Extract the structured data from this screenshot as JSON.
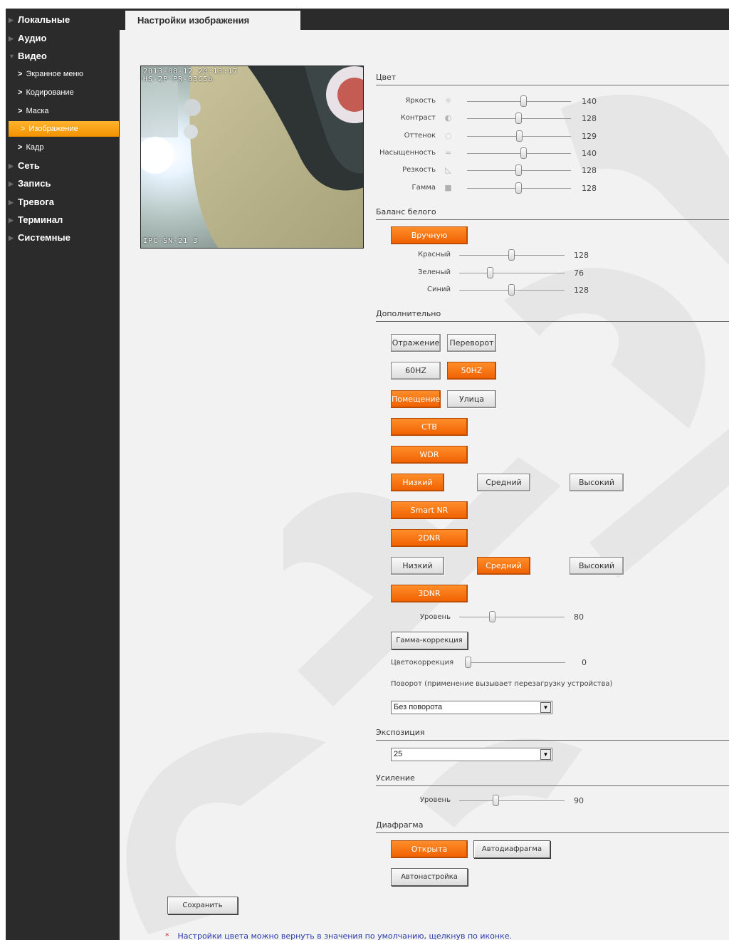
{
  "sidebar": {
    "items": [
      {
        "label": "Локальные"
      },
      {
        "label": "Аудио"
      },
      {
        "label": "Видео"
      },
      {
        "label": "Экранное меню"
      },
      {
        "label": "Кодирование"
      },
      {
        "label": "Маска"
      },
      {
        "label": "Изображение"
      },
      {
        "label": "Кадр"
      },
      {
        "label": "Сеть"
      },
      {
        "label": "Запись"
      },
      {
        "label": "Тревога"
      },
      {
        "label": "Терминал"
      },
      {
        "label": "Системные"
      }
    ],
    "active": "Изображение"
  },
  "tab": {
    "title": "Настройки изображения"
  },
  "preview": {
    "timestamp": "2013-08-12 20:13:17",
    "camera": "HS-2P PR-03C5b",
    "caption": "IPC-SN-21 3"
  },
  "color": {
    "title": "Цвет",
    "sliders": [
      {
        "label": "Яркость",
        "icon": "sun-icon",
        "value": "140",
        "fraction": 0.55
      },
      {
        "label": "Контраст",
        "icon": "contrast-icon",
        "value": "128",
        "fraction": 0.5
      },
      {
        "label": "Оттенок",
        "icon": "hue-icon",
        "value": "129",
        "fraction": 0.505
      },
      {
        "label": "Насыщенность",
        "icon": "saturation-icon",
        "value": "140",
        "fraction": 0.55
      },
      {
        "label": "Резкость",
        "icon": "sharpness-icon",
        "value": "128",
        "fraction": 0.5
      },
      {
        "label": "Гамма",
        "icon": "gamma-icon",
        "value": "128",
        "fraction": 0.5
      }
    ]
  },
  "white_balance": {
    "title": "Баланс белого",
    "mode_label": "Вручную",
    "sliders": [
      {
        "label": "Красный",
        "value": "128",
        "fraction": 0.5
      },
      {
        "label": "Зеленый",
        "value": "76",
        "fraction": 0.3
      },
      {
        "label": "Синий",
        "value": "128",
        "fraction": 0.5
      }
    ]
  },
  "advanced": {
    "title": "Дополнительно",
    "mirror": "Отражение",
    "flip": "Переворот",
    "hz60": "60HZ",
    "hz50": "50HZ",
    "indoor": "Помещение",
    "outdoor": "Улица",
    "ctb": "СТВ",
    "wdr": "WDR",
    "wdr_low": "Низкий",
    "wdr_mid": "Средний",
    "wdr_high": "Высокий",
    "smart_nr": "Smart NR",
    "dnr2": "2DNR",
    "nr_low": "Низкий",
    "nr_mid": "Средний",
    "nr_high": "Высокий",
    "dnr3": "3DNR",
    "level_label": "Уровень",
    "level_value": "80",
    "level_fraction": 0.32,
    "gamma_corr": "Гамма-коррекция",
    "color_corr_label": "Цветокоррекция",
    "color_corr_value": "0",
    "color_corr_fraction": 0.0,
    "rotation_label": "Поворот (применение вызывает перезагрузку устройства)",
    "rotation_value": "Без поворота"
  },
  "exposure": {
    "title": "Экспозиция",
    "value": "25"
  },
  "gain": {
    "title": "Усиление",
    "level_label": "Уровень",
    "level_value": "90",
    "level_fraction": 0.35
  },
  "iris": {
    "title": "Диафрагма",
    "open": "Открыта",
    "auto": "Автодиафрагма",
    "autoset": "Автонастройка"
  },
  "save_label": "Сохранить",
  "note": "Настройки цвета можно вернуть в значения по умолчанию, щелкнув по иконке.",
  "note_star": "*",
  "colors": {
    "accent": "#f47b16",
    "sidebar": "#2b2b2b",
    "panel": "#f2f2f2"
  }
}
